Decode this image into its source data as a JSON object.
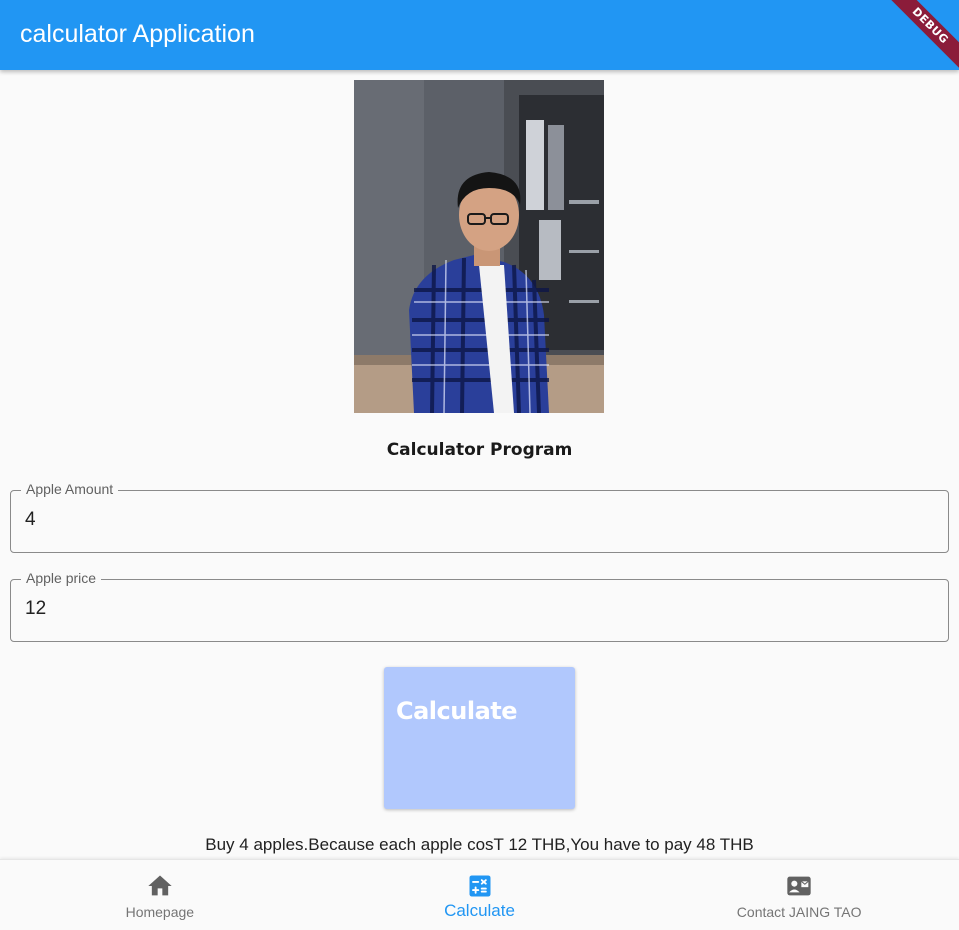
{
  "appbar": {
    "title": "calculator Application",
    "color": "#2196f3"
  },
  "debug_banner": {
    "label": "DEBUG"
  },
  "photo": {
    "description_icon": "portrait-photo"
  },
  "main": {
    "title": "Calculator Program",
    "fields": [
      {
        "label": "Apple Amount",
        "value": "4"
      },
      {
        "label": "Apple price",
        "value": "12"
      }
    ],
    "calculate_button": {
      "label": "Calculate",
      "color": "#b1c8fd"
    },
    "result_text": "Buy 4 apples.Because each apple cosT 12 THB,You have to pay 48 THB"
  },
  "bottom_nav": {
    "items": [
      {
        "label": "Homepage",
        "icon": "home-icon",
        "active": false
      },
      {
        "label": "Calculate",
        "icon": "calculator-icon",
        "active": true
      },
      {
        "label": "Contact JAING TAO",
        "icon": "contact-card-icon",
        "active": false
      }
    ],
    "active_color": "#2196f3",
    "inactive_color": "#757575"
  }
}
